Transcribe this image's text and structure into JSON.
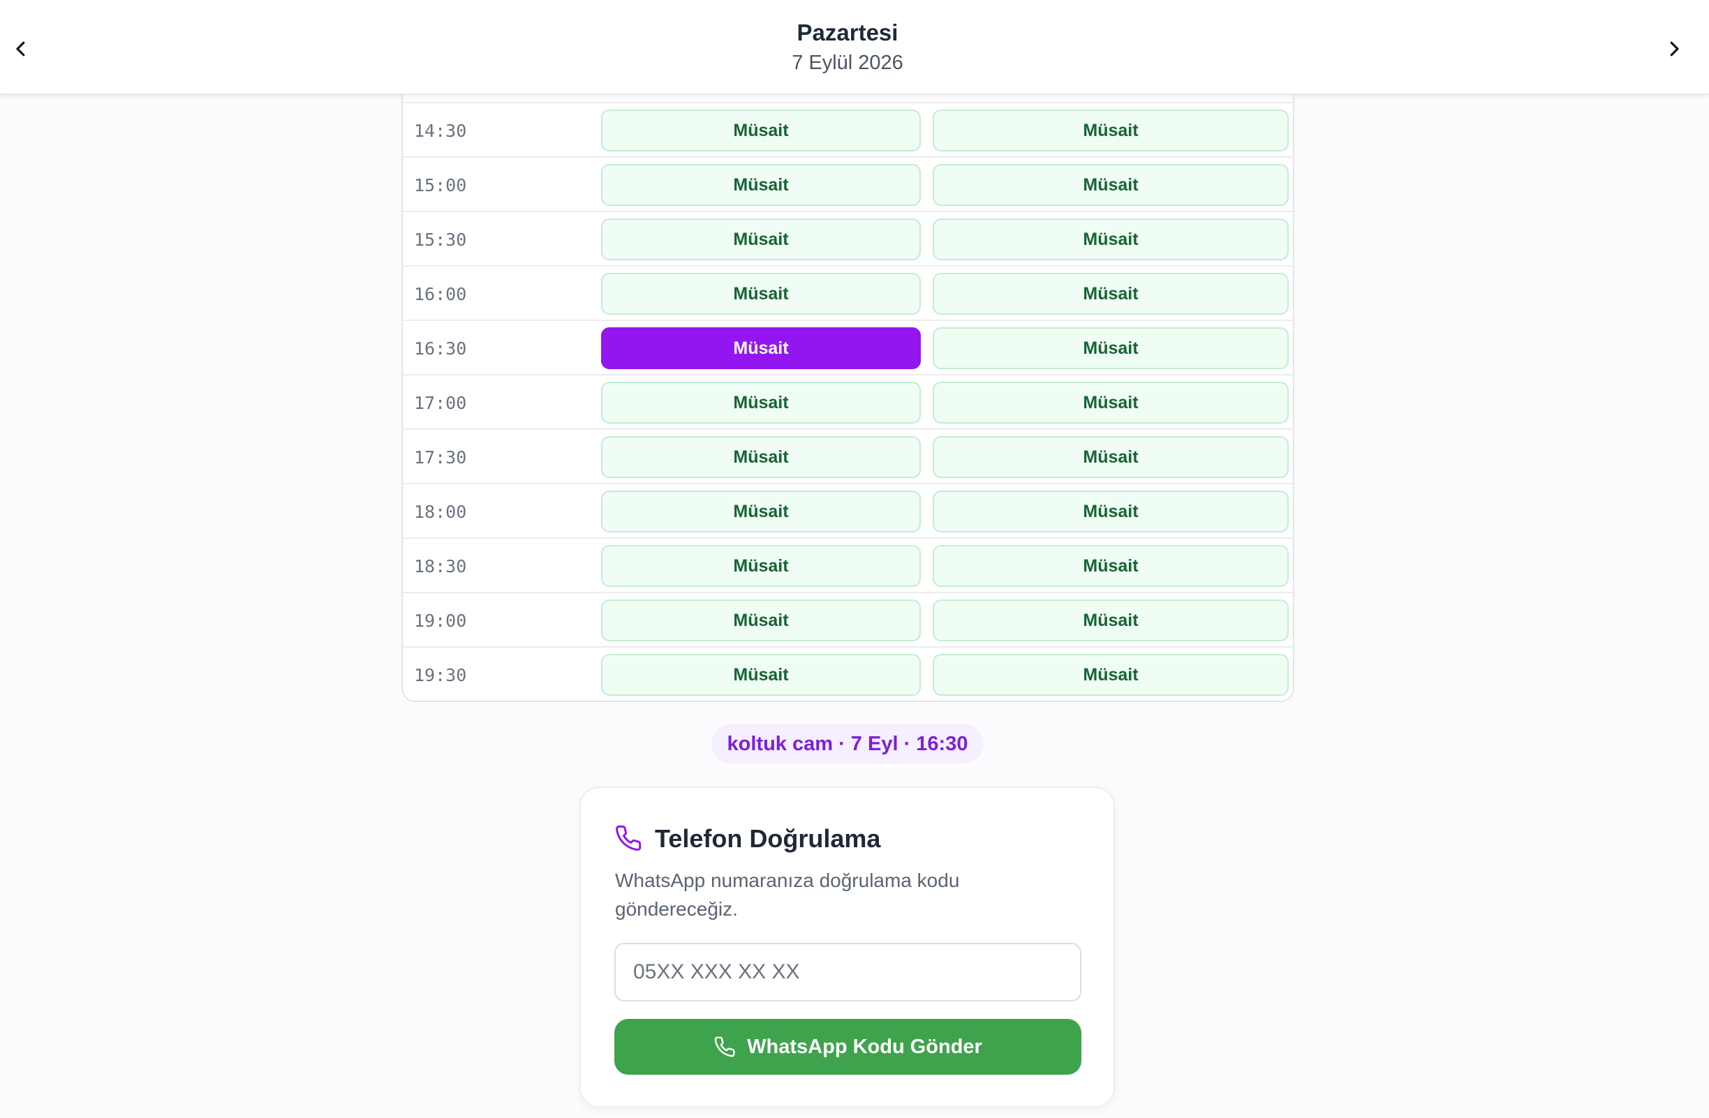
{
  "header": {
    "day": "Pazartesi",
    "date": "7 Eylül 2026",
    "prev_icon": "chevron-left-icon",
    "next_icon": "chevron-right-icon"
  },
  "schedule": {
    "available_label": "Müsait",
    "selected": {
      "time": "16:30",
      "column": 1
    },
    "rows": [
      {
        "time": "14:30",
        "slots": [
          "Müsait",
          "Müsait"
        ]
      },
      {
        "time": "15:00",
        "slots": [
          "Müsait",
          "Müsait"
        ]
      },
      {
        "time": "15:30",
        "slots": [
          "Müsait",
          "Müsait"
        ]
      },
      {
        "time": "16:00",
        "slots": [
          "Müsait",
          "Müsait"
        ]
      },
      {
        "time": "16:30",
        "slots": [
          "Müsait",
          "Müsait"
        ]
      },
      {
        "time": "17:00",
        "slots": [
          "Müsait",
          "Müsait"
        ]
      },
      {
        "time": "17:30",
        "slots": [
          "Müsait",
          "Müsait"
        ]
      },
      {
        "time": "18:00",
        "slots": [
          "Müsait",
          "Müsait"
        ]
      },
      {
        "time": "18:30",
        "slots": [
          "Müsait",
          "Müsait"
        ]
      },
      {
        "time": "19:00",
        "slots": [
          "Müsait",
          "Müsait"
        ]
      },
      {
        "time": "19:30",
        "slots": [
          "Müsait",
          "Müsait"
        ]
      }
    ]
  },
  "selection_summary": "koltuk cam · 7 Eyl · 16:30",
  "verification": {
    "icon": "phone-icon",
    "title": "Telefon Doğrulama",
    "description": "WhatsApp numaranıza doğrulama kodu göndereceğiz.",
    "phone_placeholder": "05XX XXX XX XX",
    "phone_value": "",
    "send_button": "WhatsApp Kodu Gönder"
  },
  "colors": {
    "accent_purple": "#9316f0",
    "available_bg": "#f0fdf4",
    "available_border": "#c4ecd0",
    "available_text": "#166534",
    "whatsapp_green": "#3fa34d"
  }
}
